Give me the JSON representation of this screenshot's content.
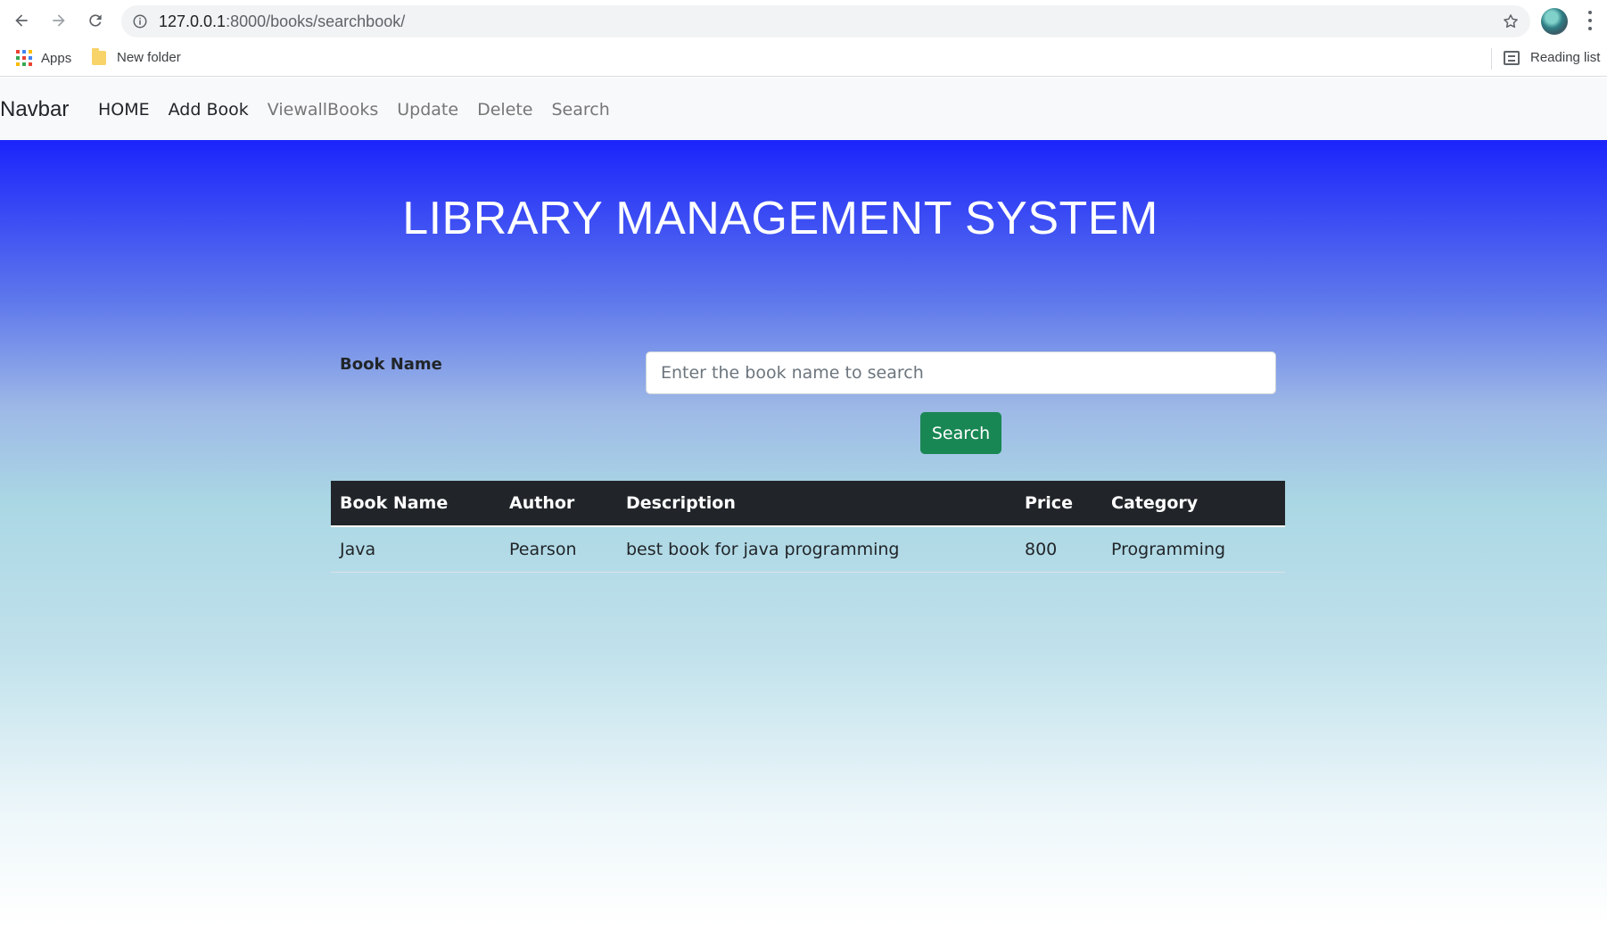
{
  "browser": {
    "url_host": "127.0.0.1",
    "url_path": ":8000/books/searchbook/",
    "bookmarks": [
      {
        "label": "Apps"
      },
      {
        "label": "New folder"
      }
    ],
    "reading_list_label": "Reading list"
  },
  "navbar": {
    "brand": "Navbar",
    "links": [
      {
        "label": "HOME",
        "state": "active"
      },
      {
        "label": "Add Book",
        "state": "active"
      },
      {
        "label": "ViewallBooks",
        "state": "muted"
      },
      {
        "label": "Update",
        "state": "muted"
      },
      {
        "label": "Delete",
        "state": "muted"
      },
      {
        "label": "Search",
        "state": "muted"
      }
    ]
  },
  "page": {
    "title": "LIBRARY MANAGEMENT SYSTEM",
    "search_form": {
      "label": "Book Name",
      "placeholder": "Enter the book name to search",
      "value": "",
      "button_label": "Search"
    },
    "results_table": {
      "columns": [
        "Book Name",
        "Author",
        "Description",
        "Price",
        "Category"
      ],
      "rows": [
        [
          "Java",
          "Pearson",
          "best book for java programming",
          "800",
          "Programming"
        ]
      ]
    }
  },
  "colors": {
    "gradient_top": "#1b24fb",
    "gradient_bottom": "#ffffff",
    "search_button": "#198754",
    "table_header": "#212529"
  }
}
